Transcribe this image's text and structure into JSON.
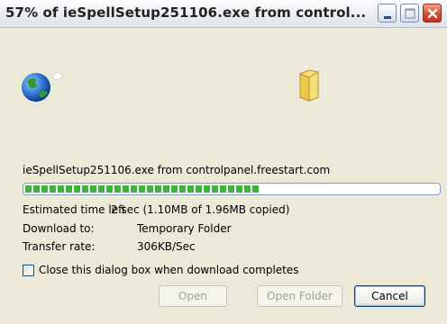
{
  "window": {
    "title": "57% of ieSpellSetup251106.exe from control...",
    "accent": "#0055e5"
  },
  "download": {
    "source_line": "ieSpellSetup251106.exe from controlpanel.freestart.com",
    "progress_percent": 57,
    "progress_color": "#3eb43e",
    "time_left_label": "Estimated time left",
    "time_left_value": "2 sec (1.10MB of 1.96MB copied)",
    "download_to_label": "Download to:",
    "download_to_value": "Temporary Folder",
    "transfer_rate_label": "Transfer rate:",
    "transfer_rate_value": "306KB/Sec"
  },
  "options": {
    "close_on_complete_label": "Close this dialog box when download completes",
    "close_on_complete_checked": false
  },
  "buttons": {
    "open": "Open",
    "open_folder": "Open Folder",
    "cancel": "Cancel"
  },
  "icons": {
    "globe": "globe-icon",
    "folder": "folder-icon",
    "minimize": "minimize-icon",
    "maximize": "maximize-icon",
    "close": "close-icon"
  }
}
